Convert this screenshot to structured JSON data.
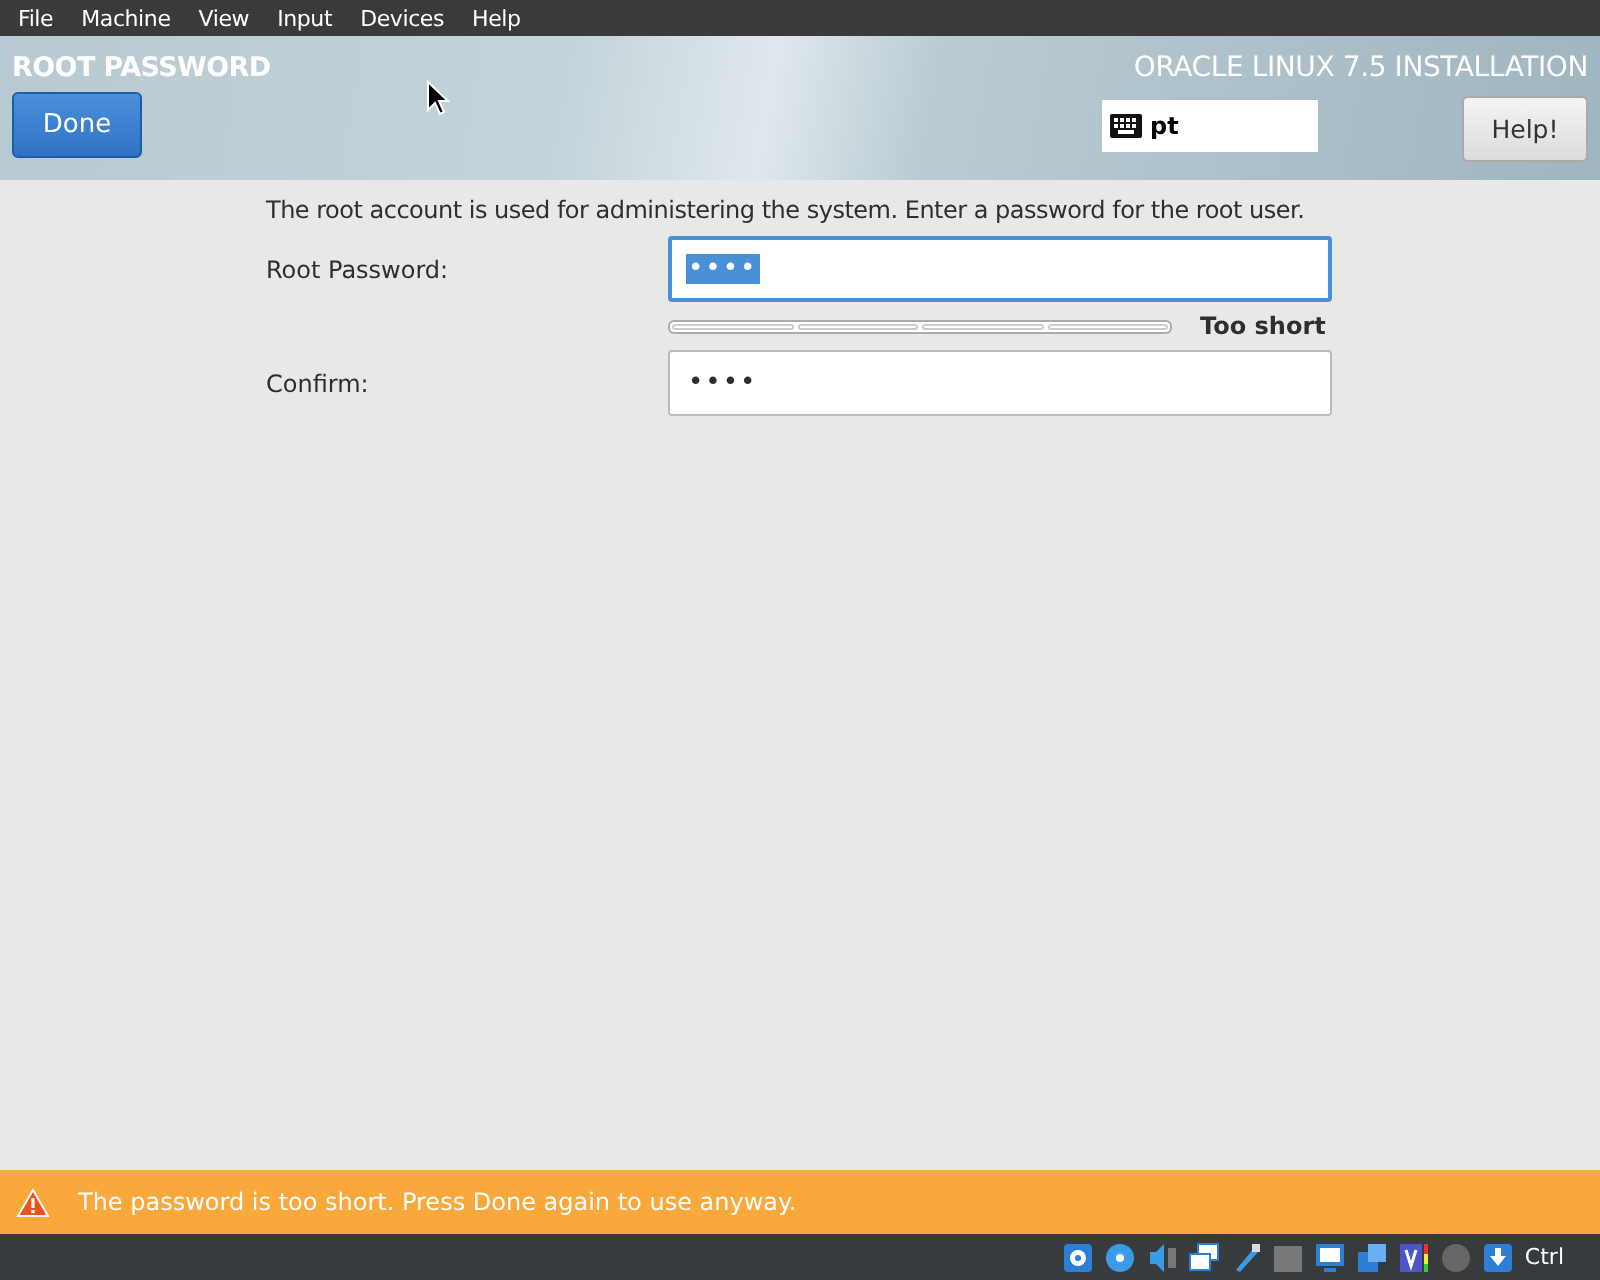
{
  "menu_bar": {
    "items": [
      "File",
      "Machine",
      "View",
      "Input",
      "Devices",
      "Help"
    ]
  },
  "header": {
    "spoke_title": "ROOT PASSWORD",
    "done_button": "Done",
    "product_title": "ORACLE LINUX 7.5 INSTALLATION",
    "keyboard_layout": "pt",
    "help_button": "Help!"
  },
  "form": {
    "description": "The root account is used for administering the system.  Enter a password for the root user.",
    "fields": [
      {
        "label": "Root Password:",
        "value": "••••",
        "focused": true,
        "text_selected": true
      },
      {
        "label": "Confirm:",
        "value": "••••",
        "focused": false,
        "text_selected": false
      }
    ],
    "strength": {
      "label": "Too short"
    }
  },
  "warning_bar": {
    "message": "The password is too short. Press Done again to use anyway."
  },
  "status_bar": {
    "host_key": "Ctrl"
  }
}
